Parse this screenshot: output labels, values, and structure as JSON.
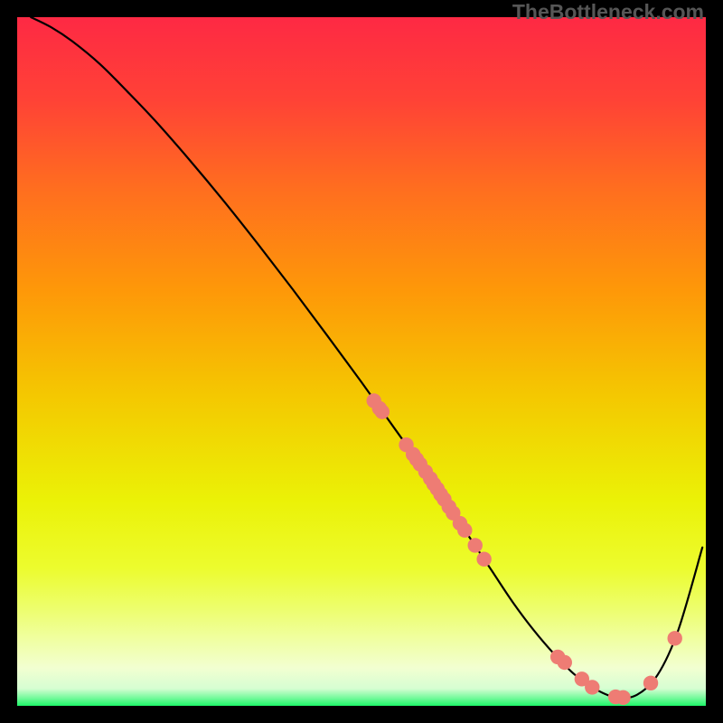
{
  "watermark": "TheBottleneck.com",
  "colors": {
    "point": "#ee7c74",
    "line": "#000000"
  },
  "chart_data": {
    "type": "line",
    "title": "",
    "xlabel": "",
    "ylabel": "",
    "xlim": [
      0,
      100
    ],
    "ylim": [
      0,
      100
    ],
    "gradient_stops": [
      {
        "offset": 0.0,
        "color": "#fe2944"
      },
      {
        "offset": 0.12,
        "color": "#ff4236"
      },
      {
        "offset": 0.25,
        "color": "#ff6e1f"
      },
      {
        "offset": 0.4,
        "color": "#fe9908"
      },
      {
        "offset": 0.55,
        "color": "#f4c801"
      },
      {
        "offset": 0.7,
        "color": "#ebf106"
      },
      {
        "offset": 0.8,
        "color": "#ecfc2e"
      },
      {
        "offset": 0.86,
        "color": "#edfe6e"
      },
      {
        "offset": 0.905,
        "color": "#f0ffa3"
      },
      {
        "offset": 0.945,
        "color": "#f2ffd1"
      },
      {
        "offset": 0.975,
        "color": "#d6fed2"
      },
      {
        "offset": 0.988,
        "color": "#79fa9e"
      },
      {
        "offset": 1.0,
        "color": "#1df668"
      }
    ],
    "series": [
      {
        "name": "curve",
        "x": [
          2,
          5,
          8,
          12,
          16,
          20,
          25,
          30,
          35,
          40,
          45,
          50,
          55,
          60,
          63,
          66,
          69,
          72,
          75,
          78,
          81,
          84,
          87,
          90,
          93,
          96,
          99.5
        ],
        "y": [
          100,
          98.5,
          96.5,
          93.2,
          89.2,
          85.0,
          79.3,
          73.3,
          67.0,
          60.5,
          53.8,
          47.0,
          40.0,
          33.0,
          28.5,
          24.0,
          19.5,
          15.0,
          11.0,
          7.5,
          4.5,
          2.4,
          1.2,
          1.6,
          4.5,
          11.0,
          23.0
        ]
      }
    ],
    "points": [
      {
        "x": 51.8,
        "y": 44.3
      },
      {
        "x": 52.6,
        "y": 43.2
      },
      {
        "x": 53.0,
        "y": 42.7
      },
      {
        "x": 56.5,
        "y": 37.9
      },
      {
        "x": 57.5,
        "y": 36.5
      },
      {
        "x": 58.0,
        "y": 35.8
      },
      {
        "x": 58.5,
        "y": 35.1
      },
      {
        "x": 59.3,
        "y": 34.0
      },
      {
        "x": 60.0,
        "y": 33.0
      },
      {
        "x": 60.5,
        "y": 32.2
      },
      {
        "x": 61.0,
        "y": 31.5
      },
      {
        "x": 61.5,
        "y": 30.7
      },
      {
        "x": 62.0,
        "y": 30.0
      },
      {
        "x": 62.7,
        "y": 28.9
      },
      {
        "x": 63.3,
        "y": 28.0
      },
      {
        "x": 64.3,
        "y": 26.5
      },
      {
        "x": 65.0,
        "y": 25.5
      },
      {
        "x": 66.5,
        "y": 23.3
      },
      {
        "x": 67.8,
        "y": 21.3
      },
      {
        "x": 78.5,
        "y": 7.1
      },
      {
        "x": 79.5,
        "y": 6.3
      },
      {
        "x": 82.0,
        "y": 3.9
      },
      {
        "x": 83.5,
        "y": 2.7
      },
      {
        "x": 86.9,
        "y": 1.3
      },
      {
        "x": 88.0,
        "y": 1.2
      },
      {
        "x": 92.0,
        "y": 3.3
      },
      {
        "x": 95.5,
        "y": 9.8
      }
    ]
  }
}
